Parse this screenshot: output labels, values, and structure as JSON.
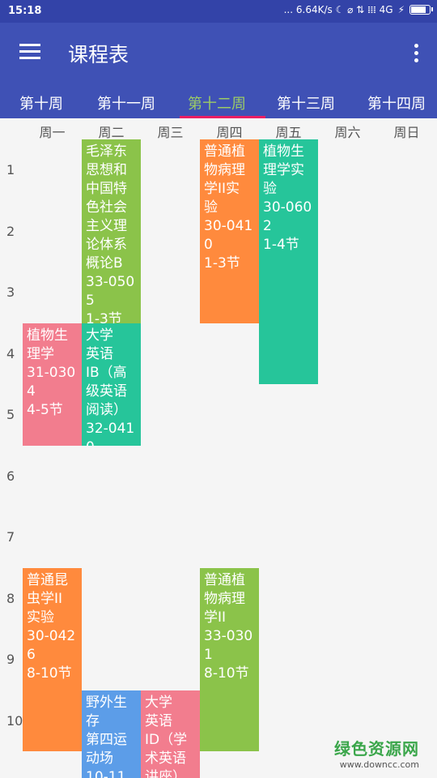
{
  "statusbar": {
    "time": "15:18",
    "indicators": "... 6.64K/s ☾ ⌀ ⇅ 𝍖 4G",
    "battery_level": 0.85
  },
  "appbar": {
    "title": "课程表",
    "menu_icon": "menu-icon",
    "more_icon": "more-vert-icon"
  },
  "weeks": [
    "第十周",
    "第十一周",
    "第十二周",
    "第十三周",
    "第十四周"
  ],
  "active_week": "第十二周",
  "days": [
    "周一",
    "周二",
    "周三",
    "周四",
    "周五",
    "周六",
    "周日"
  ],
  "periods": [
    "1",
    "2",
    "3",
    "4",
    "5",
    "6",
    "7",
    "8",
    "9",
    "10"
  ],
  "courses": [
    {
      "text": "毛泽东\n思想和\n中国特\n色社会\n主义理\n论体系\n概论B\n33-050\n5\n1-3节",
      "day": 2,
      "start": 1,
      "end": 3,
      "color": "#8bc34a"
    },
    {
      "text": "普通植\n物病理\n学II实\n验\n30-041\n0\n1-3节",
      "day": 4,
      "start": 1,
      "end": 3,
      "color": "#ff8a3d"
    },
    {
      "text": "植物生\n理学实\n验\n30-060\n2\n1-4节",
      "day": 5,
      "start": 1,
      "end": 4,
      "color": "#26c59a"
    },
    {
      "text": "植物生\n理学\n31-030\n4\n4-5节",
      "day": 1,
      "start": 4,
      "end": 5,
      "color": "#f27d8e"
    },
    {
      "text": "大学\n英语\nIB（高\n级英语\n阅读）\n32-041\n0",
      "day": 2,
      "start": 4,
      "end": 5,
      "color": "#26c59a"
    },
    {
      "text": "普通昆\n虫学II\n实验\n30-042\n6\n8-10节",
      "day": 1,
      "start": 8,
      "end": 10,
      "color": "#ff8a3d"
    },
    {
      "text": "普通植\n物病理\n学II\n33-030\n1\n8-10节",
      "day": 4,
      "start": 8,
      "end": 10,
      "color": "#8bc34a"
    },
    {
      "text": "野外生\n存\n第四运\n动场\n10-11",
      "day": 2,
      "start": 10,
      "end": 11,
      "color": "#5c9de8"
    },
    {
      "text": "大学\n英语\nID（学\n术英语\n讲座）",
      "day": 3,
      "start": 10,
      "end": 11,
      "color": "#f27d8e"
    }
  ],
  "watermark": {
    "main": "绿色资源网",
    "sub": "www.downcc.com"
  }
}
